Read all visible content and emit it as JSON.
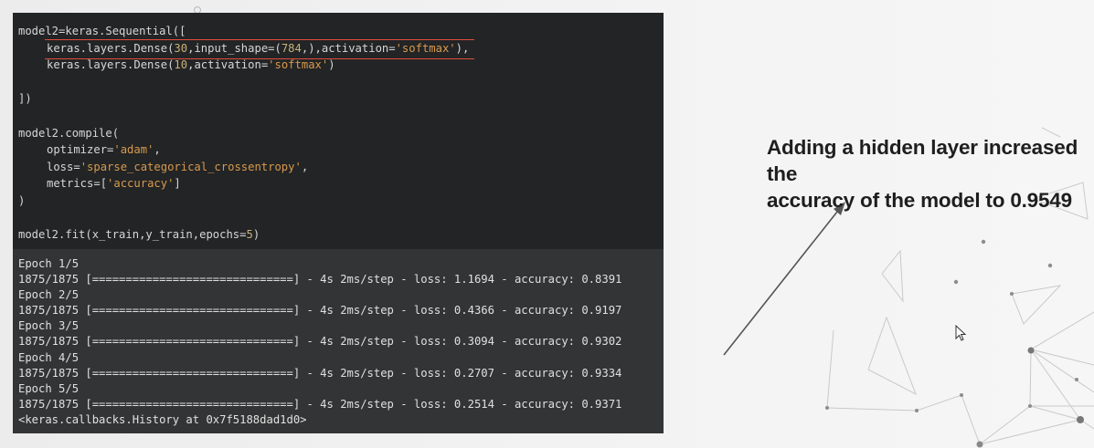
{
  "code_cell": {
    "line1": "model2=keras.Sequential([",
    "line2_prefix": "keras.layers.Dense(",
    "line2_n1": "30",
    "line2_mid": ",input_shape=(",
    "line2_n2": "784",
    "line2_mid2": ",),activation=",
    "line2_str": "'softmax'",
    "line2_end": "),",
    "line3_prefix": "keras.layers.Dense(",
    "line3_n1": "10",
    "line3_mid": ",activation=",
    "line3_str": "'softmax'",
    "line3_end": ")",
    "line5": "])",
    "line7": "model2.compile(",
    "line8_prefix": "optimizer=",
    "line8_str": "'adam'",
    "line8_end": ",",
    "line9_prefix": "loss=",
    "line9_str": "'sparse_categorical_crossentropy'",
    "line9_end": ",",
    "line10_prefix": "metrics=[",
    "line10_str": "'accuracy'",
    "line10_end": "]",
    "line11": ")",
    "line13_prefix": "model2.fit(x_train,y_train,epochs=",
    "line13_num": "5",
    "line13_end": ")"
  },
  "output_cell": {
    "lines": [
      "Epoch 1/5",
      "1875/1875 [==============================] - 4s 2ms/step - loss: 1.1694 - accuracy: 0.8391",
      "Epoch 2/5",
      "1875/1875 [==============================] - 4s 2ms/step - loss: 0.4366 - accuracy: 0.9197",
      "Epoch 3/5",
      "1875/1875 [==============================] - 4s 2ms/step - loss: 0.3094 - accuracy: 0.9302",
      "Epoch 4/5",
      "1875/1875 [==============================] - 4s 2ms/step - loss: 0.2707 - accuracy: 0.9334",
      "Epoch 5/5",
      "1875/1875 [==============================] - 4s 2ms/step - loss: 0.2514 - accuracy: 0.9371",
      "<keras.callbacks.History at 0x7f5188dad1d0>"
    ]
  },
  "annotation": {
    "line1": "Adding a hidden layer increased the",
    "line2": "accuracy of the model to 0.9549"
  },
  "colors": {
    "code_bg": "#222425",
    "output_bg": "#333435",
    "string": "#d99a4e",
    "number": "#c7b27a",
    "highlight_underline": "#e24c3f"
  }
}
